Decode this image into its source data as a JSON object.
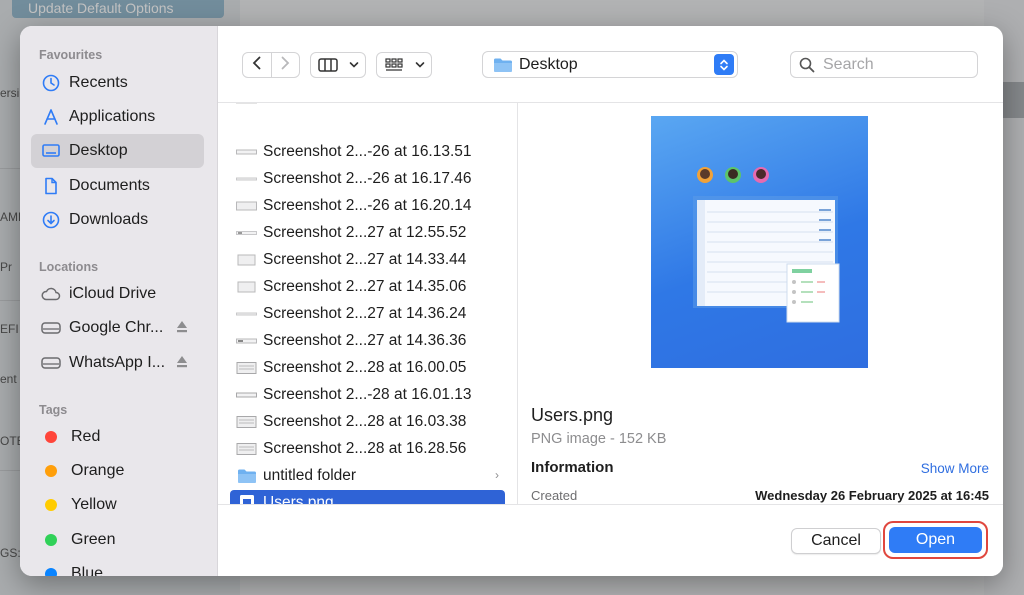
{
  "background": {
    "header_button": "Update Default Options",
    "fragments": [
      "ersi",
      "AME",
      "Pr",
      "EFI",
      "ent",
      "OTE",
      "GS:"
    ]
  },
  "sidebar": {
    "favourites_label": "Favourites",
    "favourites": [
      {
        "label": "Recents",
        "icon": "clock-icon"
      },
      {
        "label": "Applications",
        "icon": "applications-icon"
      },
      {
        "label": "Desktop",
        "icon": "desktop-icon",
        "selected": true
      },
      {
        "label": "Documents",
        "icon": "document-icon"
      },
      {
        "label": "Downloads",
        "icon": "download-icon"
      }
    ],
    "locations_label": "Locations",
    "locations": [
      {
        "label": "iCloud Drive",
        "icon": "cloud-icon"
      },
      {
        "label": "Google Chr...",
        "icon": "drive-icon",
        "eject": true
      },
      {
        "label": "WhatsApp I...",
        "icon": "drive-icon",
        "eject": true
      }
    ],
    "tags_label": "Tags",
    "tags": [
      {
        "label": "Red",
        "color": "#ff453a"
      },
      {
        "label": "Orange",
        "color": "#ff9f0a"
      },
      {
        "label": "Yellow",
        "color": "#ffcc00"
      },
      {
        "label": "Green",
        "color": "#30d158"
      },
      {
        "label": "Blue",
        "color": "#0a84ff"
      }
    ]
  },
  "toolbar": {
    "location": "Desktop",
    "search_placeholder": "Search"
  },
  "files": [
    {
      "name": "Screenshot 2...-26 at 16.13.51"
    },
    {
      "name": "Screenshot 2...-26 at 16.17.46"
    },
    {
      "name": "Screenshot 2...-26 at 16.20.14"
    },
    {
      "name": "Screenshot 2...27 at 12.55.52"
    },
    {
      "name": "Screenshot 2...27 at 14.33.44"
    },
    {
      "name": "Screenshot 2...27 at 14.35.06"
    },
    {
      "name": "Screenshot 2...27 at 14.36.24"
    },
    {
      "name": "Screenshot 2...27 at 14.36.36"
    },
    {
      "name": "Screenshot 2...28 at 16.00.05"
    },
    {
      "name": "Screenshot 2...-28 at 16.01.13"
    },
    {
      "name": "Screenshot 2...28 at 16.03.38"
    },
    {
      "name": "Screenshot 2...28 at 16.28.56"
    },
    {
      "name": "untitled folder",
      "folder": true
    },
    {
      "name": "Users.png",
      "selected": true
    }
  ],
  "preview": {
    "name": "Users.png",
    "kind": "PNG image - 152 KB",
    "info_label": "Information",
    "show_more": "Show More",
    "created_label": "Created",
    "created_value": "Wednesday 26 February 2025 at 16:45"
  },
  "footer": {
    "cancel": "Cancel",
    "open": "Open"
  },
  "colors": {
    "accent": "#2f7cf6",
    "selection": "#2f63d6",
    "highlight": "#e0473e"
  }
}
